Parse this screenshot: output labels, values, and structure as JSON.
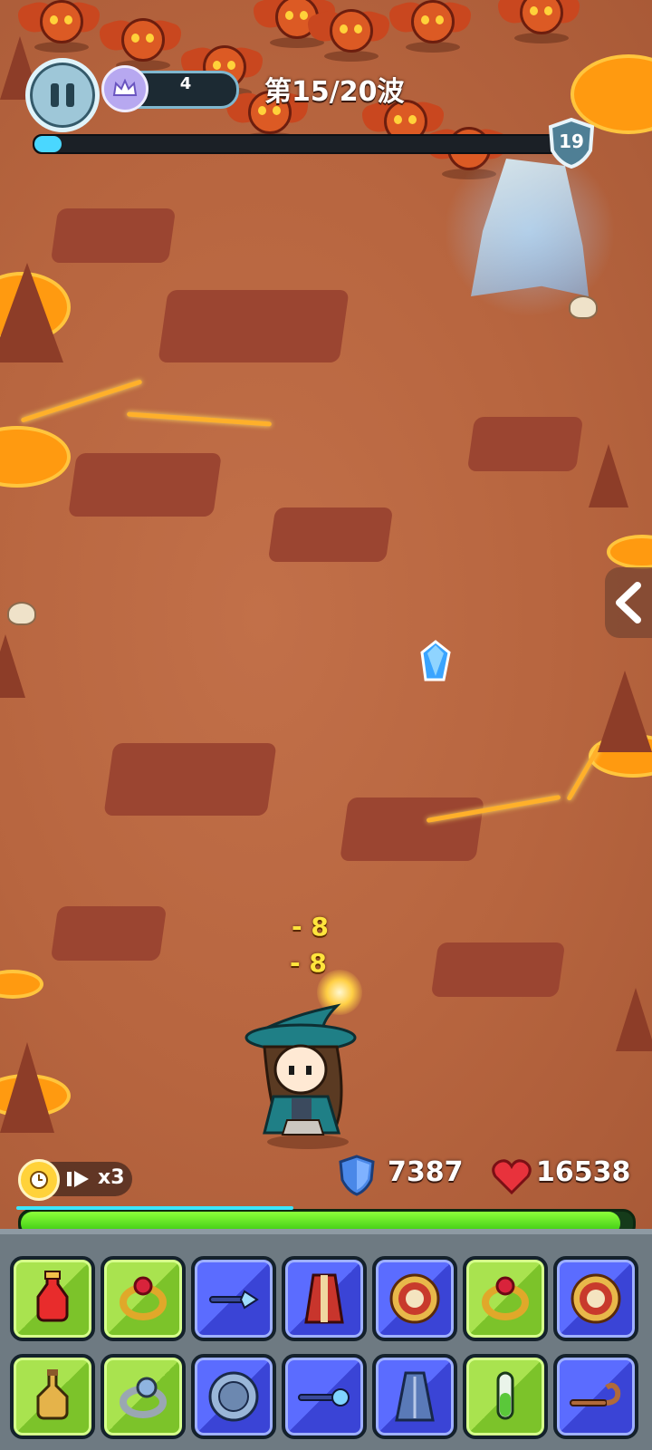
{
  "hud": {
    "crown_value": "4",
    "wave_label": "第15/20波",
    "wave_progress": 0.05,
    "level": "19"
  },
  "combat": {
    "damage_texts": [
      "- 8",
      "- 8"
    ],
    "speed_label": "x3",
    "armor": "7387",
    "health": "16538",
    "health_fraction": 0.98
  },
  "inventory": {
    "row1": [
      {
        "icon": "red-potion-icon",
        "rarity": "green"
      },
      {
        "icon": "gold-ruby-ring-icon",
        "rarity": "green"
      },
      {
        "icon": "crystal-wand-icon",
        "rarity": "blue"
      },
      {
        "icon": "red-robe-icon",
        "rarity": "blue"
      },
      {
        "icon": "round-shield-icon",
        "rarity": "blue"
      },
      {
        "icon": "gold-ruby-ring-icon",
        "rarity": "green"
      },
      {
        "icon": "round-shield-icon",
        "rarity": "blue"
      }
    ],
    "row2": [
      {
        "icon": "amber-potion-icon",
        "rarity": "green"
      },
      {
        "icon": "silver-ring-icon",
        "rarity": "green"
      },
      {
        "icon": "steel-buckler-icon",
        "rarity": "blue"
      },
      {
        "icon": "orb-scepter-icon",
        "rarity": "blue"
      },
      {
        "icon": "blue-cloak-icon",
        "rarity": "blue"
      },
      {
        "icon": "green-vial-icon",
        "rarity": "green"
      },
      {
        "icon": "hook-staff-icon",
        "rarity": "blue"
      }
    ]
  },
  "colors": {
    "ground": "#b7653f",
    "lava": "#ff9a10",
    "hp": "#2fc20c",
    "wave": "#4ad7ff"
  }
}
